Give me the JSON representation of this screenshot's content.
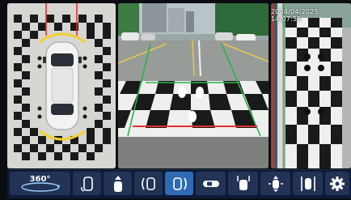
{
  "status": {
    "datetime": "2024/04/2025 14:07:55"
  },
  "views": {
    "top": {
      "name": "top-view"
    },
    "front": {
      "name": "front-camera"
    },
    "side": {
      "name": "side-camera"
    }
  },
  "toolbar": {
    "buttons": [
      {
        "id": "360",
        "label": "360°",
        "icon": "surround-view-icon",
        "active": false
      },
      {
        "id": "rear-wheel",
        "label": "",
        "icon": "rear-wheel-view-icon",
        "active": false
      },
      {
        "id": "front",
        "label": "",
        "icon": "front-view-icon",
        "active": false
      },
      {
        "id": "left",
        "label": "",
        "icon": "left-view-icon",
        "active": false
      },
      {
        "id": "right",
        "label": "",
        "icon": "right-view-icon",
        "active": true
      },
      {
        "id": "car",
        "label": "",
        "icon": "car-icon",
        "active": false
      },
      {
        "id": "front-wheel",
        "label": "",
        "icon": "front-wheel-view-icon",
        "active": false
      },
      {
        "id": "rear",
        "label": "",
        "icon": "rear-view-icon",
        "active": false
      },
      {
        "id": "side-by-side",
        "label": "",
        "icon": "side-by-side-icon",
        "active": false
      },
      {
        "id": "settings",
        "label": "",
        "icon": "gear-icon",
        "active": false
      }
    ]
  },
  "colors": {
    "active": "#2e6bb3",
    "inactive": "#223355",
    "guide_red": "#e03030",
    "guide_green": "#2bb34a",
    "guide_yellow": "#f4d02a"
  }
}
